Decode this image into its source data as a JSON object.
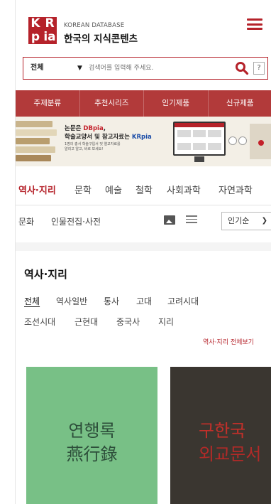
{
  "header": {
    "logo_letters": [
      "KR",
      "pia"
    ],
    "logo_en": "KOREAN DATABASE",
    "logo_kr": "한국의 지식콘텐츠",
    "menu_icon": "hamburger-icon",
    "brand_color": "#b5222a"
  },
  "search": {
    "scope": "전체",
    "placeholder": "검색어를 입력해 주세요.",
    "help_label": "?",
    "search_icon": "magnifier-icon"
  },
  "catnav": {
    "items": [
      "주제분류",
      "추천시리즈",
      "인기제품",
      "신규제품"
    ],
    "bg_color": "#b23a3a"
  },
  "banner": {
    "line1_prefix": "논문은 ",
    "line1_highlight": "DBpia",
    "line1_suffix": ",",
    "line2_prefix": "학술교양서 및 참고자료는 ",
    "line2_highlight": "KRpia",
    "line3": "1명의 총서 학술구입서 및 열교자료를 알리고 알고, 바로 보세요!"
  },
  "subcats": {
    "row1": [
      "역사·지리",
      "문학",
      "예술",
      "철학",
      "사회과학",
      "자연과학"
    ],
    "row2": [
      "문화",
      "인물전집·사전"
    ],
    "active_index": 0
  },
  "toolbar": {
    "view_image_icon": "image-view-icon",
    "view_list_icon": "list-view-icon",
    "sort_value": "인기순"
  },
  "section": {
    "title": "역사·지리",
    "nav_row1": [
      "전체",
      "역사일반",
      "통사",
      "고대",
      "고려시대"
    ],
    "nav_row2": [
      "조선시대",
      "근현대",
      "중국사",
      "지리"
    ],
    "see_all": "역사·지리 전체보기"
  },
  "books": [
    {
      "title_kr": "연행록",
      "title_han": "燕行錄",
      "bg": "#78c086"
    },
    {
      "title_kr": "구한국",
      "title_han": "외교문서",
      "bg": "#3a3630"
    }
  ]
}
